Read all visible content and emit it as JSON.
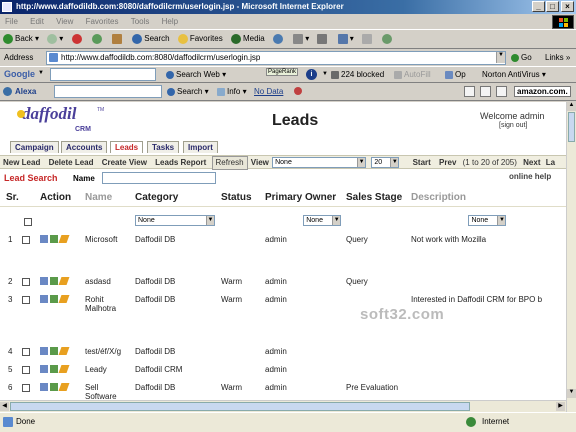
{
  "window": {
    "title": "http://www.daffodildb.com:8080/daffodilcrm/userlogin.jsp - Microsoft Internet Explorer"
  },
  "menu": [
    "File",
    "Edit",
    "View",
    "Favorites",
    "Tools",
    "Help"
  ],
  "toolbar": {
    "back": "Back",
    "search": "Search",
    "favorites": "Favorites",
    "media": "Media"
  },
  "address": {
    "label": "Address",
    "url": "http://www.daffodildb.com:8080/daffodilcrm/userlogin.jsp",
    "go": "Go",
    "links": "Links"
  },
  "google_bar": {
    "logo": "Google",
    "search_web": "Search Web",
    "pagerank": "PageRank",
    "blocked": "224 blocked",
    "autofill": "AutoFill",
    "options": "Op",
    "norton": "Norton AntiVirus"
  },
  "alexa_bar": {
    "logo": "Alexa",
    "search": "Search",
    "info": "Info",
    "nodata": "No Data",
    "amazon": "amazon.com."
  },
  "app": {
    "logo": "daffodil",
    "logo_sub": "CRM",
    "logo_tm": "TM",
    "page_title": "Leads",
    "welcome": "Welcome admin",
    "sign_out": "[sign out]",
    "tabs": [
      "Campaign",
      "Accounts",
      "Leads",
      "Tasks",
      "Import"
    ],
    "active_tab": "Leads"
  },
  "actionbar": {
    "new_lead": "New Lead",
    "delete_lead": "Delete Lead",
    "create_view": "Create View",
    "leads_report": "Leads Report",
    "refresh": "Refresh",
    "view_label": "View",
    "view_value": "None",
    "page_size": "20",
    "start": "Start",
    "prev": "Prev",
    "range": "(1 to 20 of 205)",
    "next": "Next",
    "last": "La"
  },
  "search": {
    "title": "Lead Search",
    "name_label": "Name",
    "online_help": "online help"
  },
  "table": {
    "headers": [
      "Sr.",
      "Action",
      "Name",
      "Category",
      "Status",
      "Primary Owner",
      "Sales Stage",
      "Description"
    ],
    "filters": {
      "category": "None",
      "status": "None",
      "sales_stage": "None"
    },
    "rows": [
      {
        "sr": "1",
        "name": "Microsoft",
        "category": "Daffodil DB",
        "status": "",
        "owner": "admin",
        "stage": "Query",
        "description": "Not work with Mozilla"
      },
      {
        "sr": "2",
        "name": "asdasd",
        "category": "Daffodil DB",
        "status": "Warm",
        "owner": "admin",
        "stage": "Query",
        "description": ""
      },
      {
        "sr": "3",
        "name": "Rohit Malhotra",
        "name1": "Rohit",
        "name2": "Malhotra",
        "category": "Daffodil DB",
        "status": "Warm",
        "owner": "admin",
        "stage": "",
        "description": "Interested in Daffodil CRM for BPO b"
      },
      {
        "sr": "4",
        "name": "test/éf/X/g",
        "category": "Daffodil DB",
        "status": "",
        "owner": "admin",
        "stage": "",
        "description": ""
      },
      {
        "sr": "5",
        "name": "Leady",
        "category": "Daffodil CRM",
        "status": "",
        "owner": "admin",
        "stage": "",
        "description": ""
      },
      {
        "sr": "6",
        "name": "Sell Software",
        "name1": "Sell",
        "name2": "Software",
        "category": "Daffodil DB",
        "status": "Warm",
        "owner": "admin",
        "stage": "Pre Evaluation",
        "description": ""
      }
    ]
  },
  "watermark": "soft32.com",
  "status": {
    "left": "Done",
    "zone": "Internet"
  }
}
